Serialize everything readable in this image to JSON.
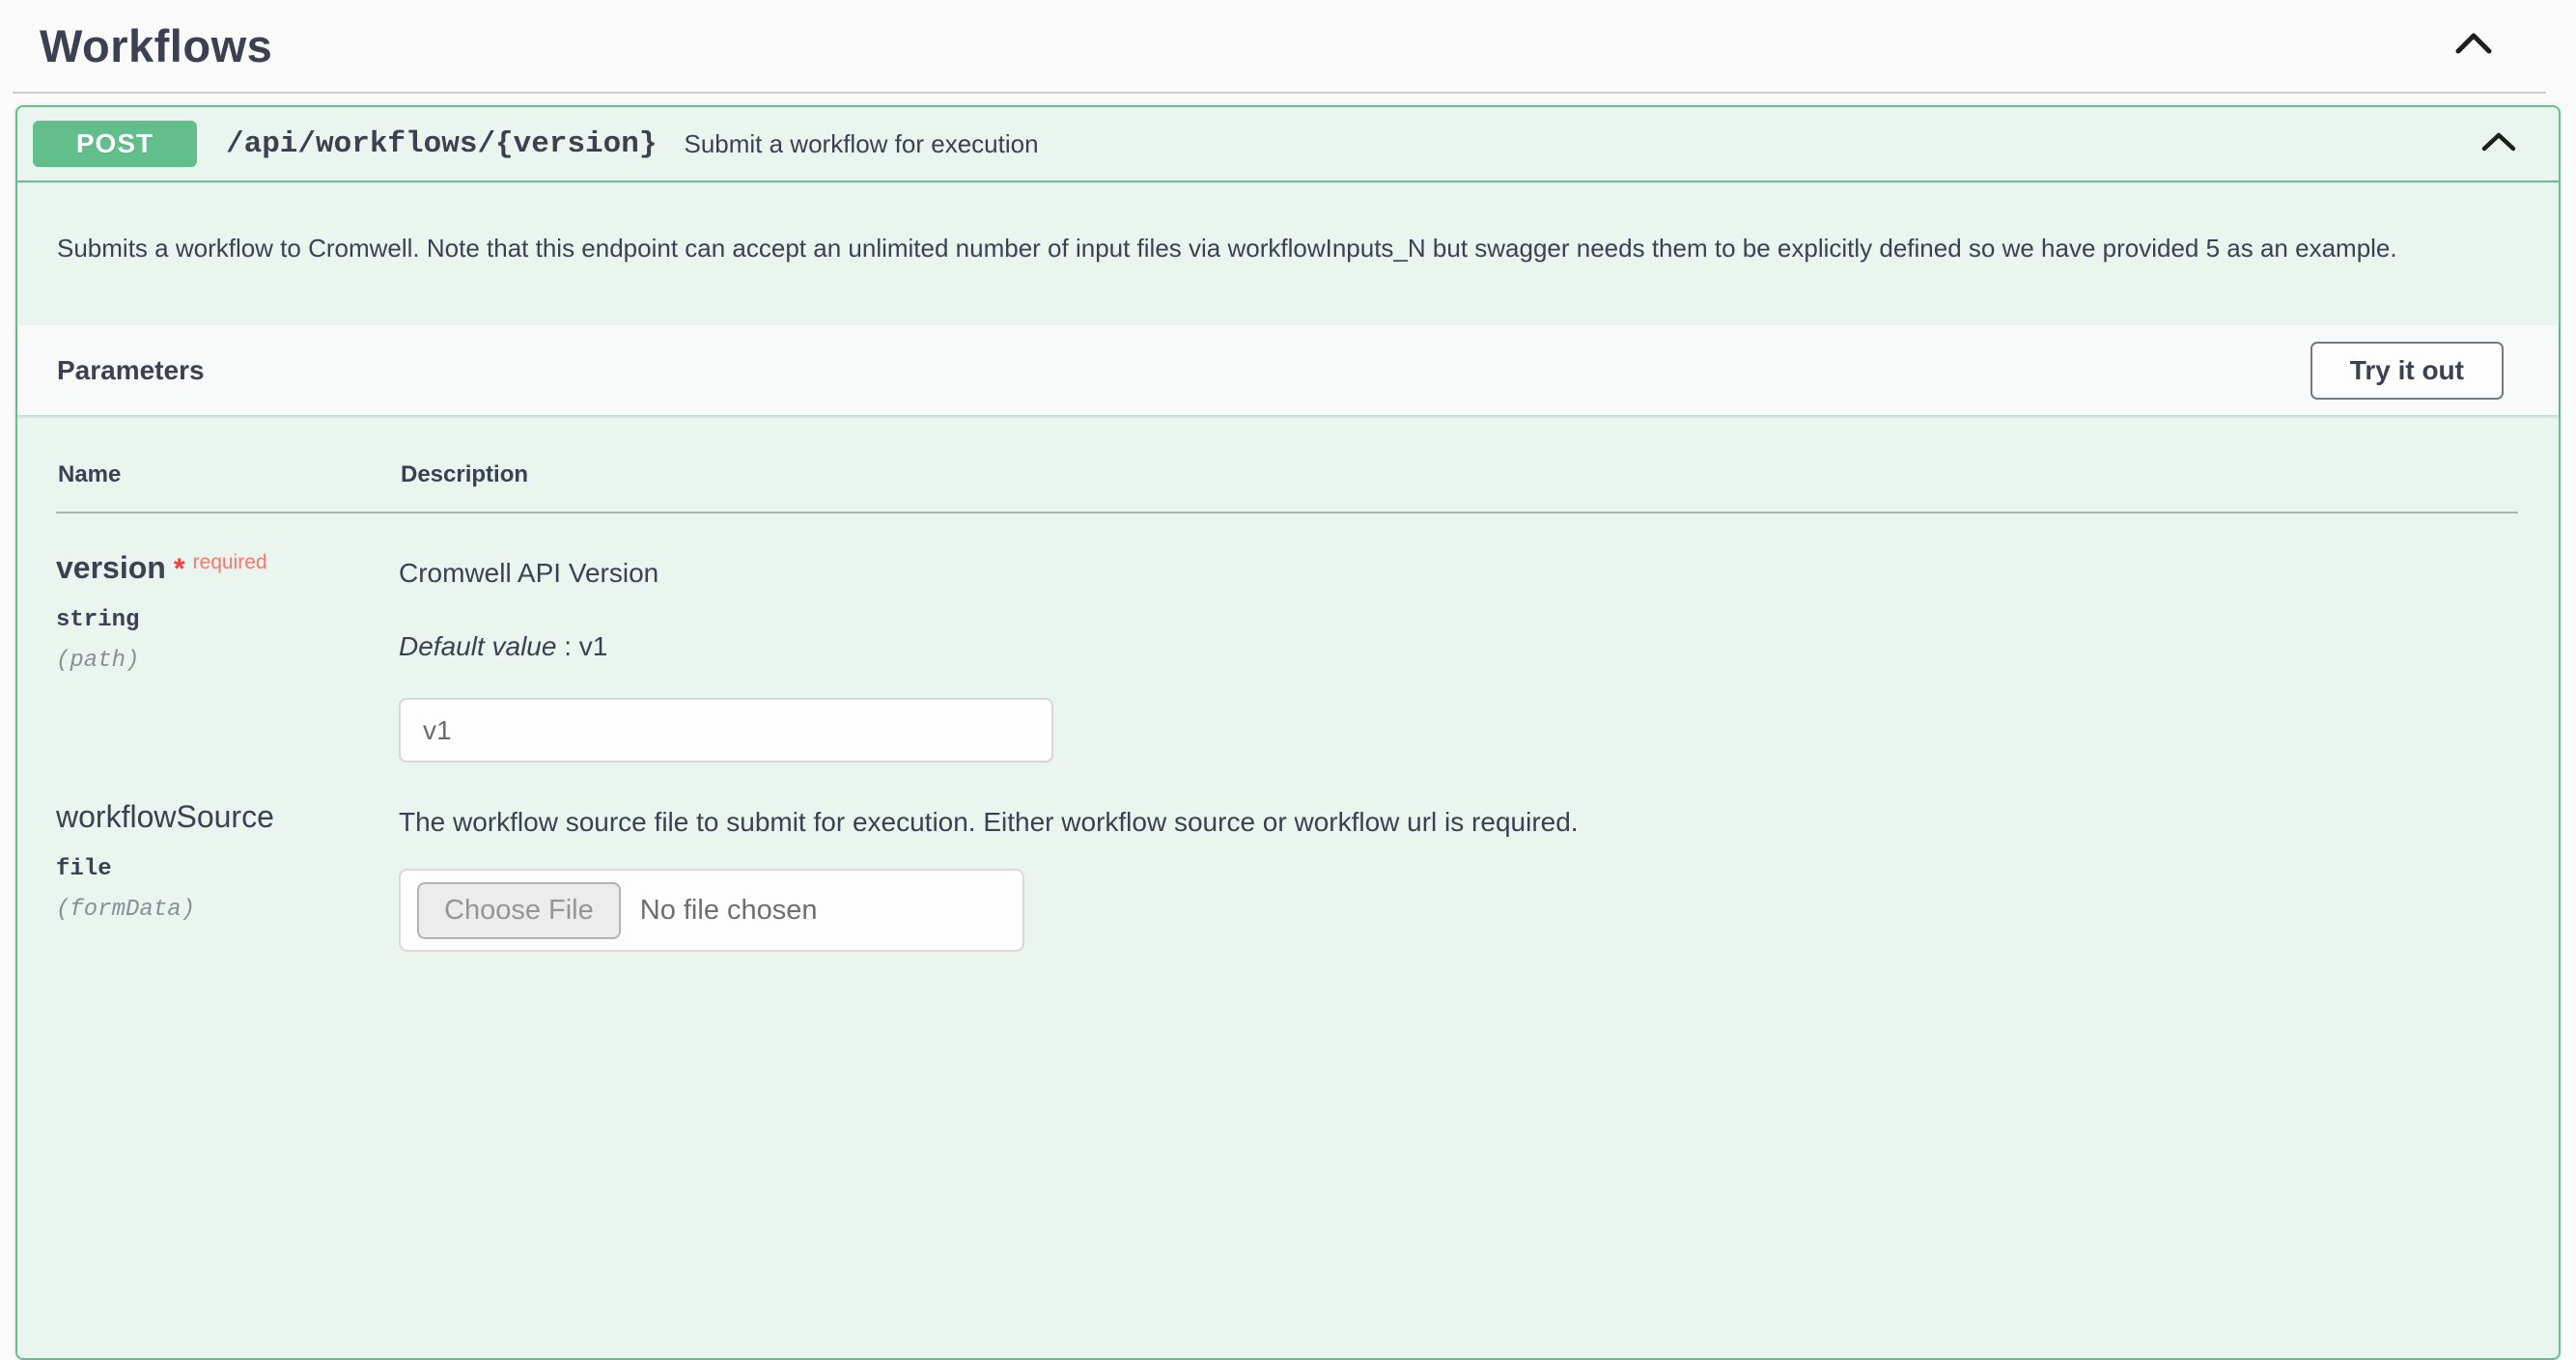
{
  "page": {
    "section_title": "Workflows"
  },
  "endpoint": {
    "method": "POST",
    "path": "/api/workflows/{version}",
    "summary": "Submit a workflow for execution",
    "description": "Submits a workflow to Cromwell. Note that this endpoint can accept an unlimited number of input files via workflowInputs_N but swagger needs them to be explicitly defined so we have provided 5 as an example."
  },
  "parameters_section": {
    "title": "Parameters",
    "try_it_out_label": "Try it out",
    "headers": {
      "name": "Name",
      "description": "Description"
    },
    "rows": [
      {
        "name": "version",
        "required_star": "*",
        "required_label": "required",
        "type": "string",
        "location": "(path)",
        "description": "Cromwell API Version",
        "default_label": "Default value",
        "default_separator": " : ",
        "default_value": "v1",
        "input_value": "v1"
      },
      {
        "name": "workflowSource",
        "type": "file",
        "location": "(formData)",
        "description": "The workflow source file to submit for execution. Either workflow source or workflow url is required.",
        "file_button_label": "Choose File",
        "file_status": "No file chosen"
      }
    ]
  },
  "colors": {
    "method_badge": "#62bf8c",
    "panel_border": "#67bf91",
    "panel_background": "#e9f5ee",
    "required_red": "#f23e3e",
    "text_primary": "#3b4151",
    "page_background": "#fafafa"
  }
}
